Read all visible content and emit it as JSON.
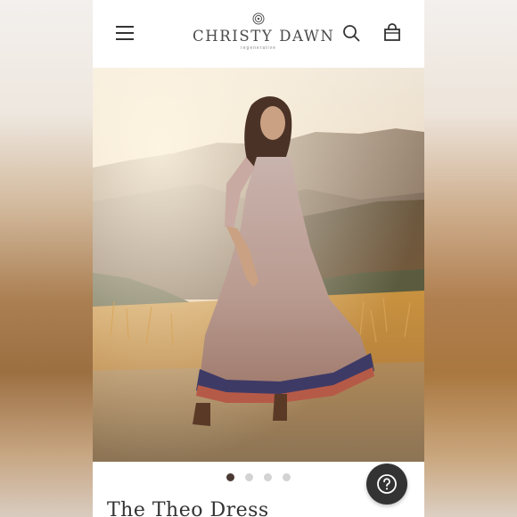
{
  "header": {
    "brand_name": "CHRISTY DAWN",
    "brand_tagline": "regenerative",
    "menu_icon": "hamburger-menu-icon",
    "search_icon": "search-icon",
    "bag_icon": "shopping-bag-icon"
  },
  "hero": {
    "image": "woman in floral tiered maxi dress standing in golden hillside field at sunset"
  },
  "carousel": {
    "total": 4,
    "active": 1
  },
  "product": {
    "title": "The Theo Dress"
  },
  "help_button": {
    "icon": "question-mark-icon"
  },
  "colors": {
    "dot_active": "#4b3a34",
    "dot_inactive": "#d3d3d3",
    "help_bg": "#333333"
  }
}
